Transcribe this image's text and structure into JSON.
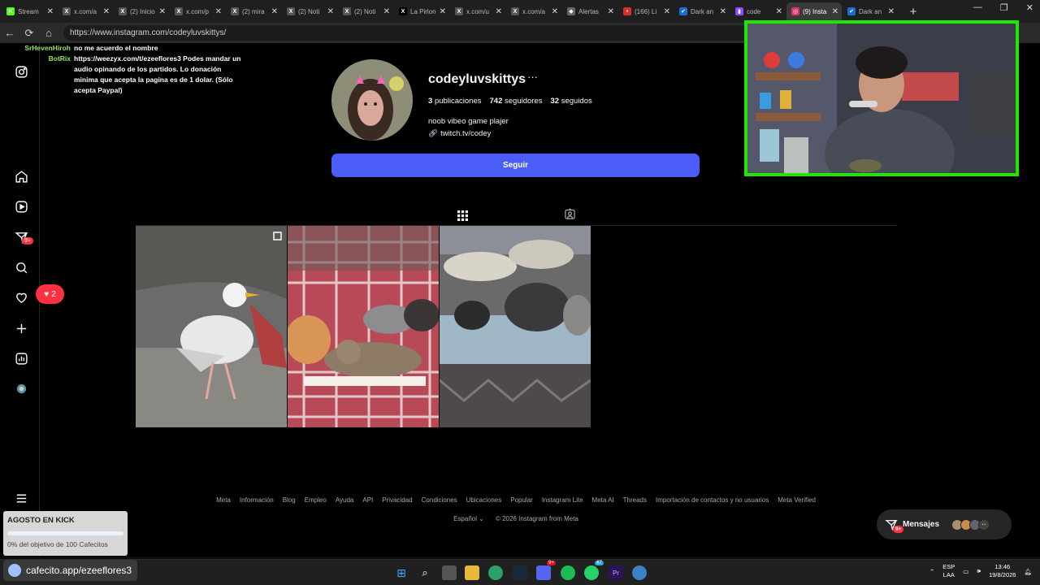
{
  "browser": {
    "tabs": [
      {
        "label": "Stream",
        "color": "#53fc18",
        "glyph": "K"
      },
      {
        "label": "x.com/a",
        "color": "#555555",
        "glyph": "X"
      },
      {
        "label": "(2) Inicio",
        "color": "#555555",
        "glyph": "X"
      },
      {
        "label": "x.com/p",
        "color": "#555555",
        "glyph": "X"
      },
      {
        "label": "(2) mira",
        "color": "#555555",
        "glyph": "X"
      },
      {
        "label": "(2) Noti",
        "color": "#555555",
        "glyph": "X"
      },
      {
        "label": "(2) Noti",
        "color": "#555555",
        "glyph": "X"
      },
      {
        "label": "La Pirlon",
        "color": "#000000",
        "glyph": "X"
      },
      {
        "label": "x.com/u",
        "color": "#555555",
        "glyph": "X"
      },
      {
        "label": "x.com/a",
        "color": "#555555",
        "glyph": "X"
      },
      {
        "label": "Alertas",
        "color": "#666666",
        "glyph": "◆"
      },
      {
        "label": "(166) Li",
        "color": "#d93025",
        "glyph": "•"
      },
      {
        "label": "Dark an",
        "color": "#1e6bd6",
        "glyph": "✔"
      },
      {
        "label": "code",
        "color": "#8a4dff",
        "glyph": "▮"
      },
      {
        "label": "(9) Insta",
        "color": "#e1306c",
        "glyph": "◎"
      },
      {
        "label": "Dark an",
        "color": "#1e6bd6",
        "glyph": "✔"
      }
    ],
    "active_tab_index": 14,
    "url": "https://www.instagram.com/codeyluvskittys/"
  },
  "chat": [
    {
      "user": "SrHevenHiroh",
      "msg": "no me acuerdo el nombre"
    },
    {
      "user": "BotRix",
      "msg": "https://weezyx.com/t/ezeeflores3 Podes mandar un audio opinando de los partidos. Lo donación minima que acepta la pagina es de 1 dolar. (Sólo acepta Paypal)"
    }
  ],
  "sidebar": {
    "messages_badge": "9+",
    "notif_count": "2"
  },
  "profile": {
    "username": "codeyluvskittys",
    "more": "···",
    "posts_count": "3",
    "posts_label": "publicaciones",
    "followers_count": "742",
    "followers_label": "seguidores",
    "following_count": "32",
    "following_label": "seguidos",
    "bio": "noob vibeo game plajer",
    "link": "twitch.tv/codey",
    "follow_label": "Seguir"
  },
  "tabs": [
    "grid-icon",
    "tagged-icon"
  ],
  "posts": [
    {
      "subject": "seagull",
      "multi": true
    },
    {
      "subject": "cats on plaid blanket",
      "multi": false
    },
    {
      "subject": "cats on bed",
      "multi": false
    }
  ],
  "footer": {
    "links": [
      "Meta",
      "Información",
      "Blog",
      "Empleo",
      "Ayuda",
      "API",
      "Privacidad",
      "Condiciones",
      "Ubicaciones",
      "Popular",
      "Instagram Lite",
      "Meta AI",
      "Threads",
      "Importación de contactos y no usuarios",
      "Meta Verified"
    ],
    "language": "Español",
    "copyright": "© 2026 Instagram from Meta"
  },
  "messages_pill": {
    "label": "Mensajes",
    "badge": "9+"
  },
  "goal": {
    "title": "AGOSTO EN KICK",
    "progress": 0,
    "desc": "0% del objetivo de 100 Cafecitos"
  },
  "taskbar": {
    "cafecito": "cafecito.app/ezeeflores3",
    "lang1": "ESP",
    "lang2": "LAA",
    "time": "13:46",
    "date": "19/8/2026",
    "discord_badge": "9+",
    "whatsapp_badge": "67"
  },
  "colors": {
    "accent": "#4a5df9",
    "badge": "#ff3040",
    "webcam_border": "#22e600"
  }
}
